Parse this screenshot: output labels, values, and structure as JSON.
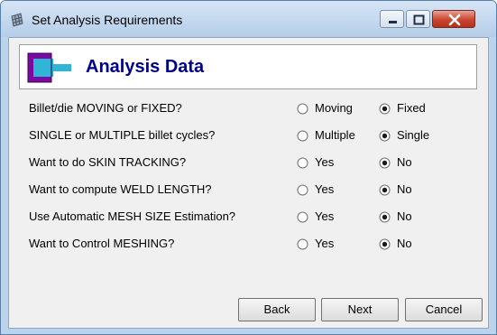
{
  "window": {
    "title": "Set Analysis Requirements"
  },
  "header": {
    "title": "Analysis Data"
  },
  "questions": [
    {
      "label": "Billet/die MOVING or FIXED?",
      "option1": "Moving",
      "option2": "Fixed",
      "selected": 2
    },
    {
      "label": "SINGLE or MULTIPLE billet cycles?",
      "option1": "Multiple",
      "option2": "Single",
      "selected": 2
    },
    {
      "label": "Want to do SKIN TRACKING?",
      "option1": "Yes",
      "option2": "No",
      "selected": 2
    },
    {
      "label": "Want to compute WELD LENGTH?",
      "option1": "Yes",
      "option2": "No",
      "selected": 2
    },
    {
      "label": "Use Automatic MESH SIZE Estimation?",
      "option1": "Yes",
      "option2": "No",
      "selected": 2
    },
    {
      "label": "Want to Control MESHING?",
      "option1": "Yes",
      "option2": "No",
      "selected": 2
    }
  ],
  "buttons": {
    "back": "Back",
    "next": "Next",
    "cancel": "Cancel"
  },
  "icons": {
    "app": "grid-table-icon",
    "header": "extrusion-die-icon",
    "minimize": "minimize-icon",
    "maximize": "maximize-icon",
    "close": "close-icon"
  },
  "colors": {
    "header_title": "#00008b",
    "close_button": "#c9462f",
    "die_icon": "#7a0aa0",
    "billet_icon": "#2fb5d6"
  }
}
